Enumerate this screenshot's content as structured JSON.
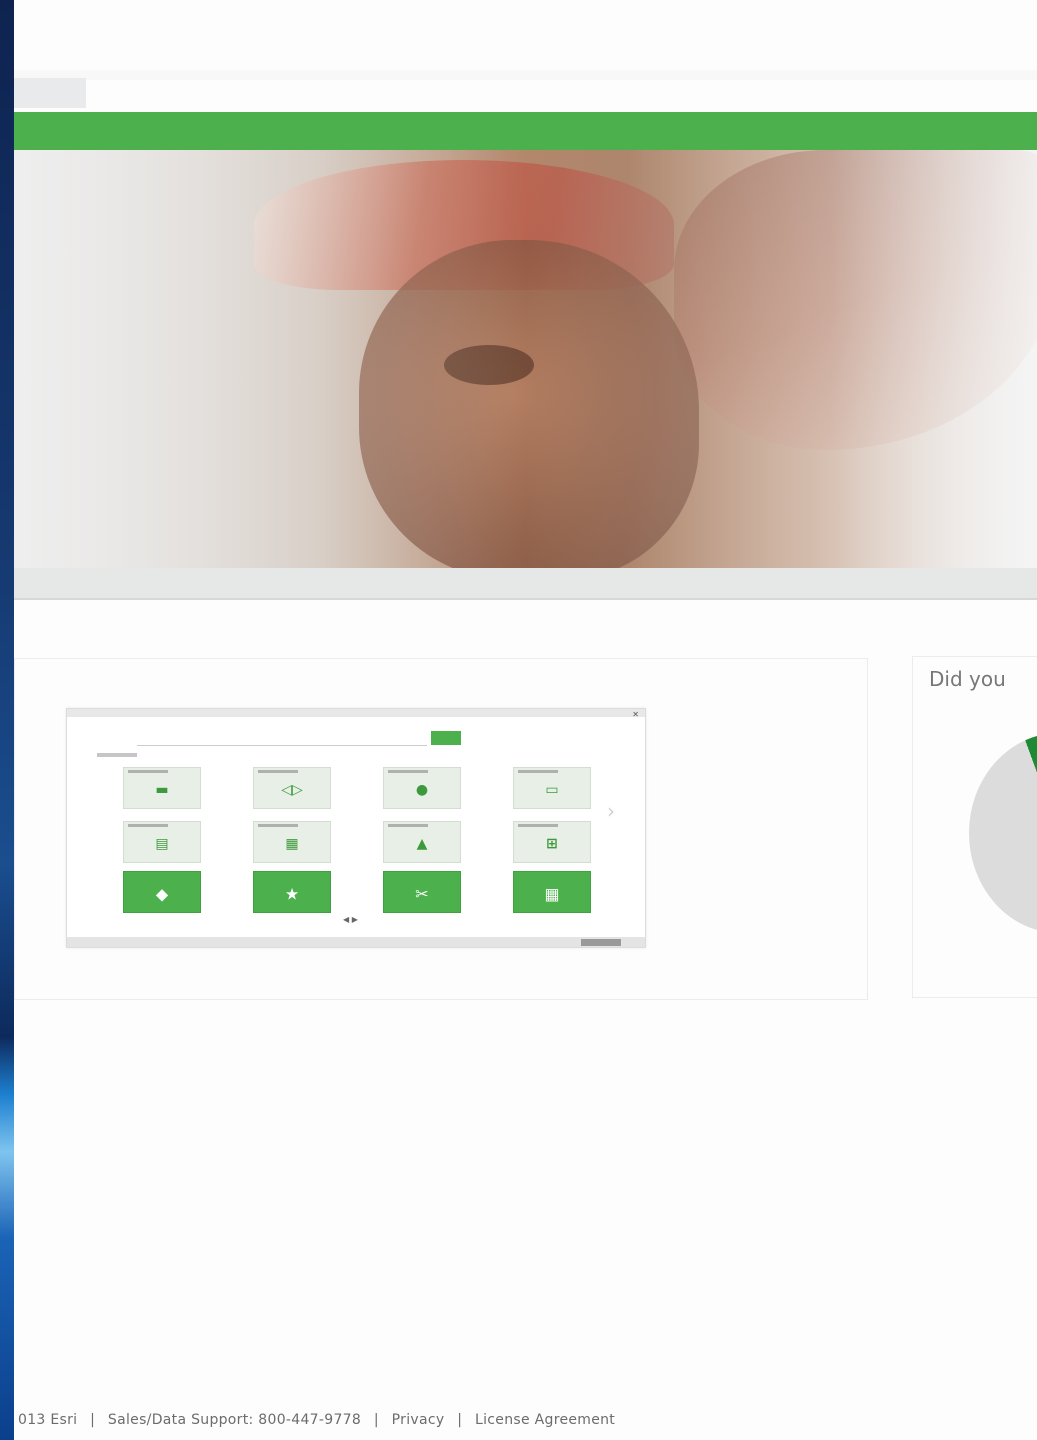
{
  "hero": {
    "image": "soldier-portrait"
  },
  "side_panel": {
    "title": "Did you"
  },
  "mini_preview": {
    "close_glyph": "✕",
    "pager": "◀ ▶",
    "tiles": [
      {
        "icon": "▬"
      },
      {
        "icon": "◁▷"
      },
      {
        "icon": "●"
      },
      {
        "icon": "▭"
      },
      {
        "icon": "▤"
      },
      {
        "icon": "▦"
      },
      {
        "icon": "▲"
      },
      {
        "icon": "⊞"
      },
      {
        "icon": "◆"
      },
      {
        "icon": "★"
      },
      {
        "icon": "✂"
      },
      {
        "icon": "▦"
      }
    ]
  },
  "pie": {
    "slices": [
      {
        "color": "#1f8a35",
        "fraction": 0.32
      },
      {
        "color": "#dcdcdc",
        "fraction": 0.68
      }
    ]
  },
  "footer": {
    "copyright": "013 Esri",
    "sep1": "|",
    "support": "Sales/Data Support: 800-447-9778",
    "sep2": "|",
    "privacy": "Privacy",
    "sep3": "|",
    "license": "License Agreement"
  },
  "colors": {
    "accent_green": "#4cb14c",
    "dark_green": "#1f8a35"
  }
}
